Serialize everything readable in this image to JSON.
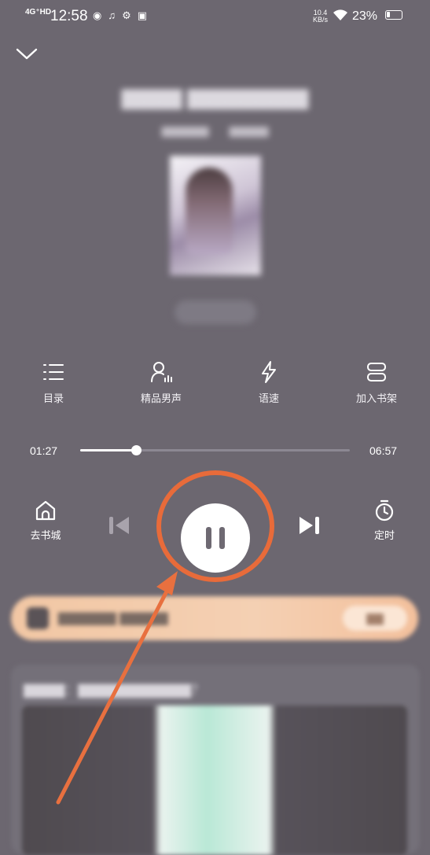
{
  "status_bar": {
    "network": "4G⁺HD",
    "time": "12:58",
    "speed_value": "10.4",
    "speed_unit": "KB/s",
    "battery": "23%"
  },
  "header": {
    "collapse_icon": "chevron-down-icon"
  },
  "functions": [
    {
      "label": "目录",
      "icon": "list-icon"
    },
    {
      "label": "精品男声",
      "icon": "voice-person-icon"
    },
    {
      "label": "语速",
      "icon": "lightning-icon"
    },
    {
      "label": "加入书架",
      "icon": "bookshelf-icon"
    }
  ],
  "playback": {
    "current_time": "01:27",
    "total_time": "06:57",
    "progress": 0.208
  },
  "controls": {
    "home_label": "去书城",
    "timer_label": "定时",
    "play_state": "pause-icon"
  },
  "colors": {
    "background": "#6c6770",
    "highlight_ring": "#e86b3a",
    "arrow": "#e8703f"
  }
}
